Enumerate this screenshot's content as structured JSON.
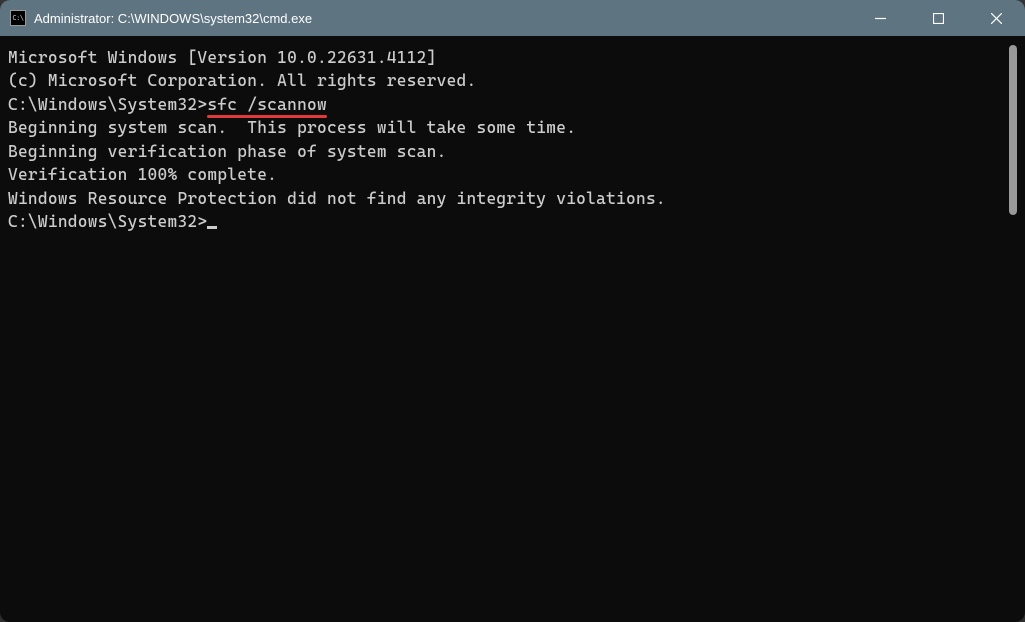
{
  "window": {
    "title": "Administrator: C:\\WINDOWS\\system32\\cmd.exe"
  },
  "terminal": {
    "line1": "Microsoft Windows [Version 10.0.22631.4112]",
    "line2": "(c) Microsoft Corporation. All rights reserved.",
    "blank1": "",
    "prompt1": "C:\\Windows\\System32>",
    "command1": "sfc /scannow",
    "blank2": "",
    "line3": "Beginning system scan.  This process will take some time.",
    "blank3": "",
    "line4": "Beginning verification phase of system scan.",
    "line5": "Verification 100% complete.",
    "blank4": "",
    "line6": "Windows Resource Protection did not find any integrity violations.",
    "blank5": "",
    "prompt2": "C:\\Windows\\System32>"
  },
  "icon": {
    "cmd": "C:\\"
  }
}
